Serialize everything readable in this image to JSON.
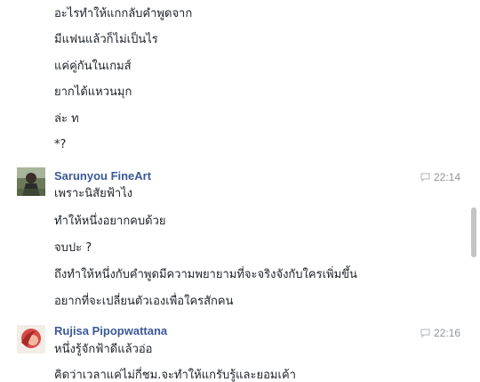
{
  "messages_group1": [
    "อะไรทำให้แกกลับคำพูดจาก",
    "มีแฟนแล้วก็ไม่เป็นไร",
    "แค่คู่กันในเกมส์",
    "ยากได้แหวนมุก",
    "ล่ะ ท",
    "*?"
  ],
  "sender2": {
    "name": "Sarunyou FineArt",
    "time": "22:14",
    "messages": [
      "เพราะนิสัยฟ้าไง",
      "ทำให้หนึ่งอยากคบด้วย",
      "จบปะ ?",
      "ถึงทำให้หนึ่งกับคำพูดมีความพยายามที่จะจริงจังกับใครเพิ่มขึ้น",
      "อยากที่จะเปลี่ยนตัวเองเพื่อใครสักคน"
    ]
  },
  "sender3": {
    "name": "Rujisa Pipopwattana",
    "time": "22:16",
    "messages": [
      "หนึ่งรู้จักฟ้าดีแล้วอ่อ",
      "คิดว่าเวลาแค่ไม่กี่ชม.จะทำให้แกรับรู้และยอมเค้า"
    ]
  },
  "colors": {
    "name": "#3b5998",
    "text": "#1d2129",
    "timestamp": "#90949c"
  }
}
